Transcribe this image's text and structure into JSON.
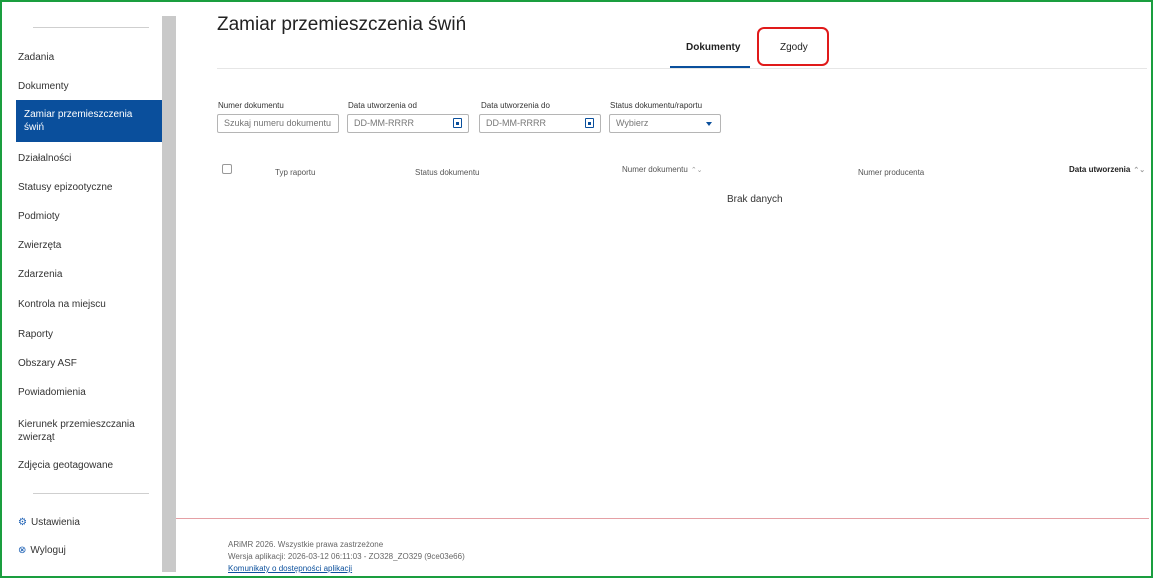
{
  "sidebar": {
    "items": [
      {
        "label": "Zadania"
      },
      {
        "label": "Dokumenty"
      },
      {
        "label": "Zamiar przemieszczenia świń",
        "active": true
      },
      {
        "label": "Działalności"
      },
      {
        "label": "Statusy epizootyczne"
      },
      {
        "label": "Podmioty"
      },
      {
        "label": "Zwierzęta"
      },
      {
        "label": "Zdarzenia"
      },
      {
        "label": "Kontrola na miejscu"
      },
      {
        "label": "Raporty"
      },
      {
        "label": "Obszary ASF"
      },
      {
        "label": "Powiadomienia"
      },
      {
        "label": "Kierunek przemieszczania zwierząt"
      },
      {
        "label": "Zdjęcia geotagowane"
      }
    ],
    "bottom": [
      {
        "label": "Ustawienia",
        "icon": "gear-icon"
      },
      {
        "label": "Wyloguj",
        "icon": "logout-icon"
      }
    ]
  },
  "header": {
    "title": "Zamiar przemieszczenia świń",
    "tabs": [
      {
        "label": "Dokumenty",
        "active": true
      },
      {
        "label": "Zgody",
        "active": false
      }
    ]
  },
  "filters": {
    "doc_number": {
      "label": "Numer dokumentu",
      "placeholder": "Szukaj numeru dokumentu"
    },
    "date_from": {
      "label": "Data utworzenia od",
      "placeholder": "DD-MM-RRRR"
    },
    "date_to": {
      "label": "Data utworzenia do",
      "placeholder": "DD-MM-RRRR"
    },
    "status": {
      "label": "Status dokumentu/raportu",
      "placeholder": "Wybierz"
    }
  },
  "table": {
    "columns": [
      "Typ raportu",
      "Status dokumentu",
      "Numer dokumentu",
      "Numer producenta",
      "Data utworzenia"
    ],
    "empty": "Brak danych"
  },
  "footer": {
    "copyright": "ARiMR 2026. Wszystkie prawa zastrzeżone",
    "version": "Wersja aplikacji: 2026-03-12 06:11:03 - ZO328_ZO329 (9ce03e66)",
    "link": "Komunikaty o dostępności aplikacji"
  },
  "colors": {
    "accent": "#0a4f9c",
    "highlight": "#e01a1a",
    "frame": "#1a9e3f"
  }
}
